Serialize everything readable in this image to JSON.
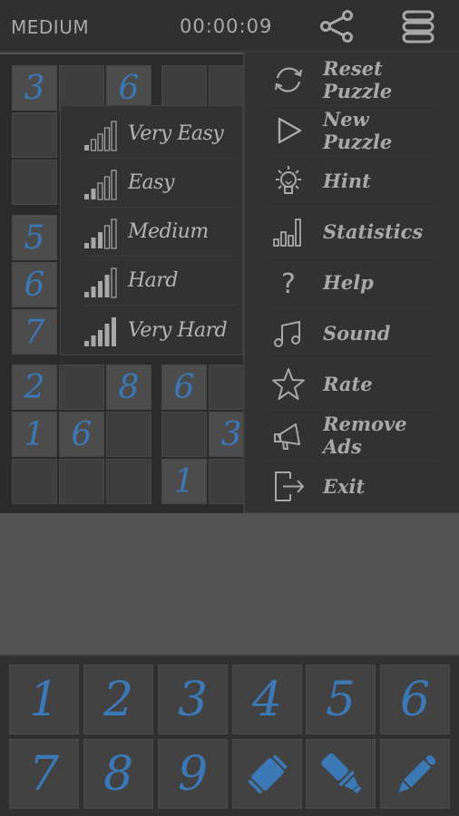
{
  "header": {
    "difficulty": "MEDIUM",
    "timer": "00:00:09",
    "share_icon": "share-icon",
    "menu_icon": "menu-icon"
  },
  "colors": {
    "digit": "#3c78b5",
    "text": "#a8a8a8",
    "background": "#535353",
    "panel": "#323232"
  },
  "board": {
    "cells": [
      {
        "row": 0,
        "col": 0,
        "value": "3"
      },
      {
        "row": 0,
        "col": 1,
        "value": ""
      },
      {
        "row": 0,
        "col": 2,
        "value": "6"
      },
      {
        "row": 0,
        "col": 3,
        "value": ""
      },
      {
        "row": 0,
        "col": 4,
        "value": ""
      },
      {
        "row": 1,
        "col": 0,
        "value": ""
      },
      {
        "row": 2,
        "col": 0,
        "value": ""
      },
      {
        "row": 3,
        "col": 0,
        "value": "5"
      },
      {
        "row": 4,
        "col": 0,
        "value": "6"
      },
      {
        "row": 5,
        "col": 0,
        "value": "7"
      },
      {
        "row": 6,
        "col": 0,
        "value": "2"
      },
      {
        "row": 6,
        "col": 1,
        "value": ""
      },
      {
        "row": 6,
        "col": 2,
        "value": "8"
      },
      {
        "row": 6,
        "col": 3,
        "value": "6"
      },
      {
        "row": 6,
        "col": 4,
        "value": ""
      },
      {
        "row": 7,
        "col": 0,
        "value": "1"
      },
      {
        "row": 7,
        "col": 1,
        "value": "6"
      },
      {
        "row": 7,
        "col": 2,
        "value": ""
      },
      {
        "row": 7,
        "col": 3,
        "value": ""
      },
      {
        "row": 7,
        "col": 4,
        "value": "3"
      },
      {
        "row": 8,
        "col": 0,
        "value": ""
      },
      {
        "row": 8,
        "col": 1,
        "value": ""
      },
      {
        "row": 8,
        "col": 2,
        "value": ""
      },
      {
        "row": 8,
        "col": 3,
        "value": "1"
      },
      {
        "row": 8,
        "col": 4,
        "value": ""
      }
    ]
  },
  "difficulty_menu": {
    "items": [
      {
        "label": "Very Easy",
        "level": 1
      },
      {
        "label": "Easy",
        "level": 2
      },
      {
        "label": "Medium",
        "level": 3
      },
      {
        "label": "Hard",
        "level": 4
      },
      {
        "label": "Very Hard",
        "level": 5
      }
    ]
  },
  "main_menu": {
    "items": [
      {
        "label": "Reset Puzzle",
        "icon": "refresh-icon"
      },
      {
        "label": "New Puzzle",
        "icon": "play-icon"
      },
      {
        "label": "Hint",
        "icon": "lightbulb-icon"
      },
      {
        "label": "Statistics",
        "icon": "bar-chart-icon"
      },
      {
        "label": "Help",
        "icon": "question-icon"
      },
      {
        "label": "Sound",
        "icon": "music-note-icon"
      },
      {
        "label": "Rate",
        "icon": "star-icon"
      },
      {
        "label": "Remove Ads",
        "icon": "megaphone-icon"
      },
      {
        "label": "Exit",
        "icon": "exit-icon"
      }
    ]
  },
  "numpad": {
    "digits": [
      "1",
      "2",
      "3",
      "4",
      "5",
      "6",
      "7",
      "8",
      "9"
    ],
    "tools": [
      {
        "name": "eraser",
        "icon": "eraser-icon"
      },
      {
        "name": "highlighter",
        "icon": "highlighter-icon"
      },
      {
        "name": "pencil",
        "icon": "pencil-icon"
      }
    ]
  }
}
